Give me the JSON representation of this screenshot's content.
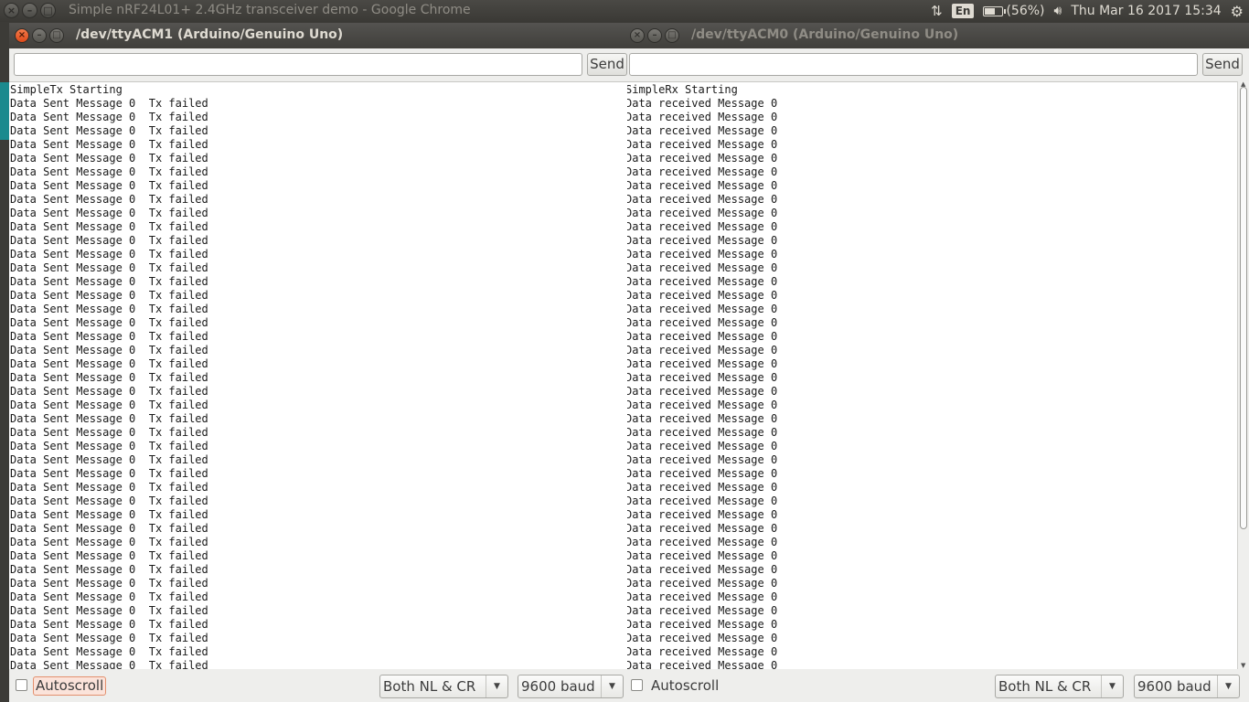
{
  "system_bar": {
    "window_title": "Simple nRF24L01+ 2.4GHz transceiver demo - Google Chrome",
    "language": "En",
    "battery_percent": 56,
    "battery_label": "(56%)",
    "datetime": "Thu Mar 16 2017 15:34"
  },
  "left_window": {
    "title": "/dev/ttyACM1 (Arduino/Genuino Uno)",
    "send_input_value": "",
    "send_label": "Send",
    "output_lines": [
      "SimpleTx Starting",
      "Data Sent Message 0  Tx failed",
      "Data Sent Message 0  Tx failed",
      "Data Sent Message 0  Tx failed",
      "Data Sent Message 0  Tx failed",
      "Data Sent Message 0  Tx failed",
      "Data Sent Message 0  Tx failed",
      "Data Sent Message 0  Tx failed",
      "Data Sent Message 0  Tx failed",
      "Data Sent Message 0  Tx failed",
      "Data Sent Message 0  Tx failed",
      "Data Sent Message 0  Tx failed",
      "Data Sent Message 0  Tx failed",
      "Data Sent Message 0  Tx failed",
      "Data Sent Message 0  Tx failed",
      "Data Sent Message 0  Tx failed",
      "Data Sent Message 0  Tx failed",
      "Data Sent Message 0  Tx failed",
      "Data Sent Message 0  Tx failed",
      "Data Sent Message 0  Tx failed",
      "Data Sent Message 0  Tx failed",
      "Data Sent Message 0  Tx failed",
      "Data Sent Message 0  Tx failed",
      "Data Sent Message 0  Tx failed",
      "Data Sent Message 0  Tx failed",
      "Data Sent Message 0  Tx failed",
      "Data Sent Message 0  Tx failed",
      "Data Sent Message 0  Tx failed",
      "Data Sent Message 0  Tx failed",
      "Data Sent Message 0  Tx failed",
      "Data Sent Message 0  Tx failed",
      "Data Sent Message 0  Tx failed",
      "Data Sent Message 0  Tx failed",
      "Data Sent Message 0  Tx failed",
      "Data Sent Message 0  Tx failed",
      "Data Sent Message 0  Tx failed",
      "Data Sent Message 0  Tx failed",
      "Data Sent Message 0  Tx failed",
      "Data Sent Message 0  Tx failed",
      "Data Sent Message 0  Tx failed",
      "Data Sent Message 0  Tx failed",
      "Data Sent Message 0  Tx failed",
      "Data Sent Message 0  Tx failed"
    ],
    "autoscroll_label": "Autoscroll",
    "autoscroll_checked": false,
    "line_ending_value": "Both NL & CR",
    "baud_value": "9600 baud"
  },
  "right_window": {
    "title": "/dev/ttyACM0 (Arduino/Genuino Uno)",
    "send_input_value": "",
    "send_label": "Send",
    "output_lines": [
      "SimpleRx Starting",
      "Data received Message 0",
      "Data received Message 0",
      "Data received Message 0",
      "Data received Message 0",
      "Data received Message 0",
      "Data received Message 0",
      "Data received Message 0",
      "Data received Message 0",
      "Data received Message 0",
      "Data received Message 0",
      "Data received Message 0",
      "Data received Message 0",
      "Data received Message 0",
      "Data received Message 0",
      "Data received Message 0",
      "Data received Message 0",
      "Data received Message 0",
      "Data received Message 0",
      "Data received Message 0",
      "Data received Message 0",
      "Data received Message 0",
      "Data received Message 0",
      "Data received Message 0",
      "Data received Message 0",
      "Data received Message 0",
      "Data received Message 0",
      "Data received Message 0",
      "Data received Message 0",
      "Data received Message 0",
      "Data received Message 0",
      "Data received Message 0",
      "Data received Message 0",
      "Data received Message 0",
      "Data received Message 0",
      "Data received Message 0",
      "Data received Message 0",
      "Data received Message 0",
      "Data received Message 0",
      "Data received Message 0",
      "Data received Message 0",
      "Data received Message 0",
      "Data received Message 0"
    ],
    "autoscroll_label": "Autoscroll",
    "autoscroll_checked": false,
    "line_ending_value": "Both NL & CR",
    "baud_value": "9600 baud"
  },
  "icons": {
    "window_close": "close-icon",
    "window_minimize": "minimize-icon",
    "window_maximize": "maximize-icon",
    "network": "network-arrows-icon",
    "battery": "battery-icon",
    "volume": "speaker-icon",
    "settings": "gear-icon",
    "dropdown": "chevron-down-icon"
  },
  "colors": {
    "close_button": "#df4a1a",
    "autoscroll_highlight": "#fbe3da",
    "teal_background": "#1b8a8e"
  }
}
